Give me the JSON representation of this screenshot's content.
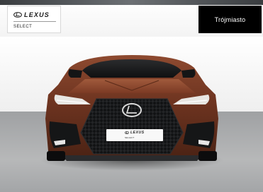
{
  "brand": {
    "wordmark": "LEXUS",
    "sub_label": "SELECT"
  },
  "location_button": {
    "label": "Trójmiasto"
  },
  "license_plate": {
    "wordmark": "LEXUS",
    "sub_label": "SELECT"
  },
  "colors": {
    "body_paint": "#7a3f2a",
    "button_bg": "#000000",
    "button_text": "#ffffff"
  },
  "icons": [
    "lexus-emblem-icon"
  ]
}
